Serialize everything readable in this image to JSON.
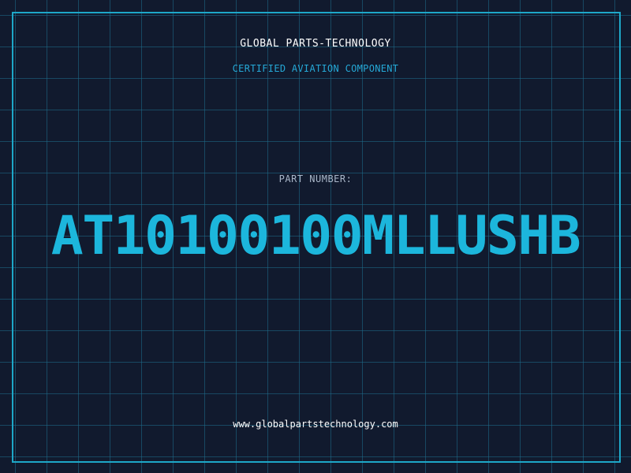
{
  "header": {
    "company": "GLOBAL PARTS-TECHNOLOGY",
    "subtitle": "CERTIFIED AVIATION COMPONENT"
  },
  "part": {
    "label": "PART NUMBER:",
    "number": "AT10100100MLLUSHB"
  },
  "footer": {
    "url": "www.globalpartstechnology.com"
  },
  "colors": {
    "background": "#111a2e",
    "grid": "#1e6e8c",
    "accent": "#1cb6dc",
    "frame": "#1ea7c8",
    "label": "#a9b6c8",
    "text": "#ffffff"
  }
}
